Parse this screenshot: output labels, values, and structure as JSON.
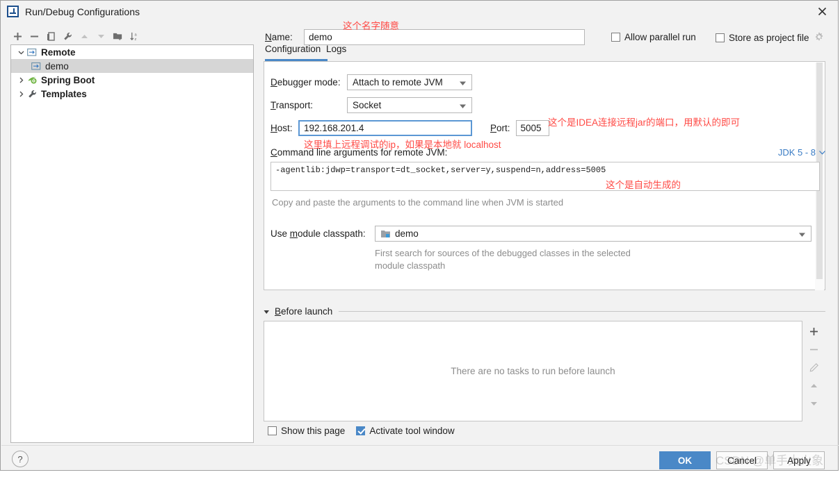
{
  "window": {
    "title": "Run/Debug Configurations",
    "close_label": "✕"
  },
  "toolbar": {
    "items": [
      {
        "name": "add",
        "glyph": "+"
      },
      {
        "name": "remove",
        "glyph": "−"
      },
      {
        "name": "copy",
        "glyph": "copy"
      },
      {
        "name": "edit-templates",
        "glyph": "wrench"
      },
      {
        "name": "move-up",
        "glyph": "▲"
      },
      {
        "name": "move-down",
        "glyph": "▼"
      },
      {
        "name": "new-folder",
        "glyph": "folder-plus"
      },
      {
        "name": "sort",
        "glyph": "sort-az"
      }
    ]
  },
  "tree": {
    "items": [
      {
        "label": "Remote",
        "level": 0,
        "expanded": true,
        "bold": true,
        "selected": false,
        "icon": "remote-icon"
      },
      {
        "label": "demo",
        "level": 1,
        "expanded": null,
        "bold": false,
        "selected": true,
        "icon": "remote-icon"
      },
      {
        "label": "Spring Boot",
        "level": 0,
        "expanded": false,
        "bold": true,
        "selected": false,
        "icon": "spring-icon"
      },
      {
        "label": "Templates",
        "level": 0,
        "expanded": false,
        "bold": true,
        "selected": false,
        "icon": "wrench-icon"
      }
    ]
  },
  "name_row": {
    "label": "Name:",
    "value": "demo",
    "allow_parallel_run": {
      "label": "Allow parallel run",
      "checked": false
    },
    "store_as_project_file": {
      "label": "Store as project file",
      "checked": false
    }
  },
  "tabs": {
    "items": [
      {
        "label": "Configuration",
        "active": true
      },
      {
        "label": "Logs",
        "active": false
      }
    ]
  },
  "form": {
    "debugger_mode": {
      "label": "Debugger mode:",
      "value": "Attach to remote JVM"
    },
    "transport": {
      "label": "Transport:",
      "value": "Socket"
    },
    "host": {
      "label": "Host:",
      "value": "192.168.201.4"
    },
    "port": {
      "label": "Port:",
      "value": "5005"
    },
    "cmdline": {
      "label": "Command line arguments for remote JVM:",
      "value": "-agentlib:jdwp=transport=dt_socket,server=y,suspend=n,address=5005",
      "hint": "Copy and paste the arguments to the command line when JVM is started",
      "jdk_selector": "JDK 5 - 8"
    },
    "module_classpath": {
      "label": "Use module classpath:",
      "value": "demo",
      "hint_line1": "First search for sources of the debugged classes in the selected",
      "hint_line2": "module classpath"
    }
  },
  "before_launch": {
    "title": "Before launch",
    "empty_text": "There are no tasks to run before launch",
    "side_buttons": [
      {
        "name": "add",
        "glyph": "+"
      },
      {
        "name": "remove",
        "glyph": "−"
      },
      {
        "name": "edit",
        "glyph": "pencil"
      },
      {
        "name": "move-up",
        "glyph": "▲"
      },
      {
        "name": "move-down",
        "glyph": "▼"
      }
    ]
  },
  "bottom": {
    "show_this_page": {
      "label": "Show this page",
      "checked": false
    },
    "activate_tool_window": {
      "label": "Activate tool window",
      "checked": true
    },
    "ok": "OK",
    "cancel": "Cancel",
    "apply": "Apply",
    "help": "?"
  },
  "annotations": {
    "name_note": "这个名字随意",
    "port_note": "这个是IDEA连接远程jar的端口，用默认的即可",
    "host_note": "这里填上远程调试的ip，如果是本地就 localhost",
    "args_note": "这个是自动生成的"
  },
  "watermark": "CSDN @单手大火象",
  "colors": {
    "accent": "#4a88c7",
    "annotation": "#ff4a45",
    "link": "#3a7cc4"
  }
}
